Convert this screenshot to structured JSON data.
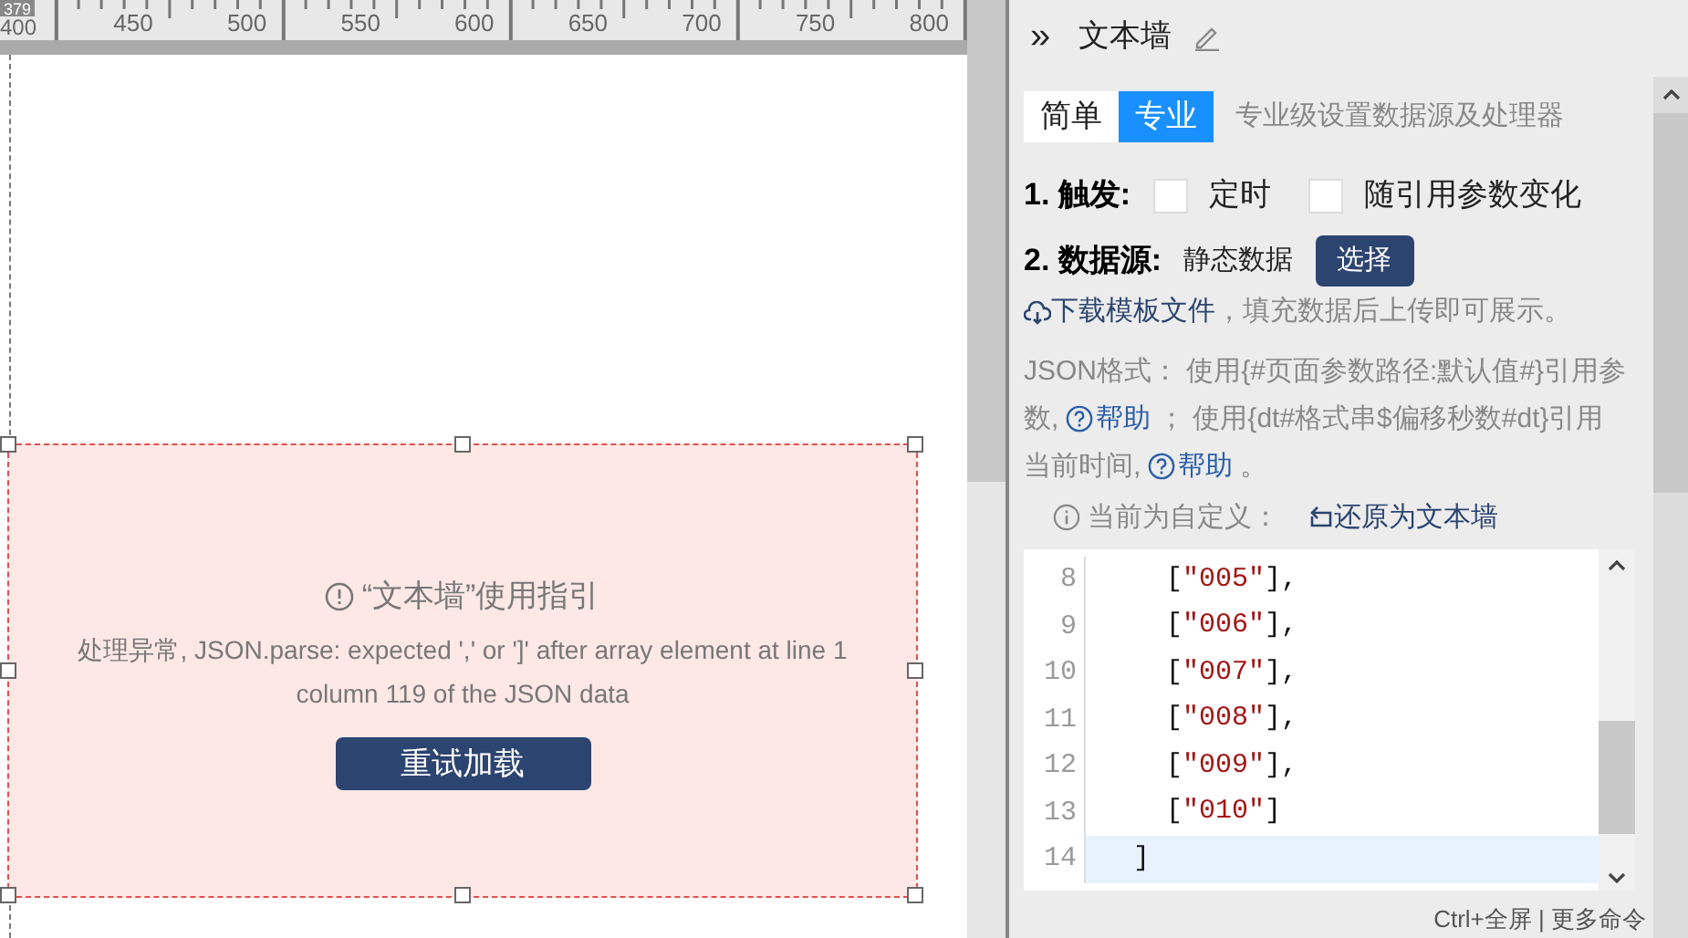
{
  "ruler": {
    "marker": "379",
    "labels": [
      "400",
      "450",
      "500",
      "550",
      "600",
      "650",
      "700",
      "750",
      "800"
    ]
  },
  "widget": {
    "title": "“文本墙”使用指引",
    "message": "处理异常, JSON.parse: expected ',' or ']' after array element at line 1 column 119 of the JSON data",
    "retry_button": "重试加载",
    "selected": true
  },
  "panel": {
    "collapse": "»",
    "title": "文本墙",
    "tabs": [
      {
        "label": "简单",
        "selected": false
      },
      {
        "label": "专业",
        "selected": true
      }
    ],
    "tabs_hint": "专业级设置数据源及处理器",
    "trigger": {
      "label": "1. 触发:",
      "options": [
        {
          "label": "定时",
          "checked": false
        },
        {
          "label": "随引用参数变化",
          "checked": false
        }
      ]
    },
    "data_source": {
      "label": "2. 数据源:",
      "value": "静态数据",
      "button": "选择"
    },
    "download": {
      "link": "下载模板文件",
      "text": "，填充数据后上传即可展示。"
    },
    "json_help": {
      "parts": [
        {
          "kind": "text",
          "text": "JSON格式： 使用{#页面参数路径:默认值#}引用参数, "
        },
        {
          "kind": "link",
          "text": "帮助"
        },
        {
          "kind": "text",
          "text": " ； 使用{dt#格式串$偏移秒数#dt}引用当前时间, "
        },
        {
          "kind": "link",
          "text": "帮助"
        },
        {
          "kind": "text",
          "text": " 。"
        }
      ]
    },
    "custom": {
      "label": "当前为自定义：",
      "link": "还原为文本墙"
    },
    "editor": {
      "lines": [
        {
          "number": "8",
          "active": false,
          "tokens": [
            {
              "kind": "punct",
              "text": "    ["
            },
            {
              "kind": "string",
              "text": "\"005\""
            },
            {
              "kind": "punct",
              "text": "],"
            }
          ]
        },
        {
          "number": "9",
          "active": false,
          "tokens": [
            {
              "kind": "punct",
              "text": "    ["
            },
            {
              "kind": "string",
              "text": "\"006\""
            },
            {
              "kind": "punct",
              "text": "],"
            }
          ]
        },
        {
          "number": "10",
          "active": false,
          "tokens": [
            {
              "kind": "punct",
              "text": "    ["
            },
            {
              "kind": "string",
              "text": "\"007\""
            },
            {
              "kind": "punct",
              "text": "],"
            }
          ]
        },
        {
          "number": "11",
          "active": false,
          "tokens": [
            {
              "kind": "punct",
              "text": "    ["
            },
            {
              "kind": "string",
              "text": "\"008\""
            },
            {
              "kind": "punct",
              "text": "],"
            }
          ]
        },
        {
          "number": "12",
          "active": false,
          "tokens": [
            {
              "kind": "punct",
              "text": "    ["
            },
            {
              "kind": "string",
              "text": "\"009\""
            },
            {
              "kind": "punct",
              "text": "],"
            }
          ]
        },
        {
          "number": "13",
          "active": false,
          "tokens": [
            {
              "kind": "punct",
              "text": "    ["
            },
            {
              "kind": "string",
              "text": "\"010\""
            },
            {
              "kind": "punct",
              "text": "]"
            }
          ]
        },
        {
          "number": "14",
          "active": true,
          "tokens": [
            {
              "kind": "punct",
              "text": "  ]"
            }
          ]
        }
      ]
    },
    "shortcut_hint": "Ctrl+全屏 | 更多命令"
  }
}
